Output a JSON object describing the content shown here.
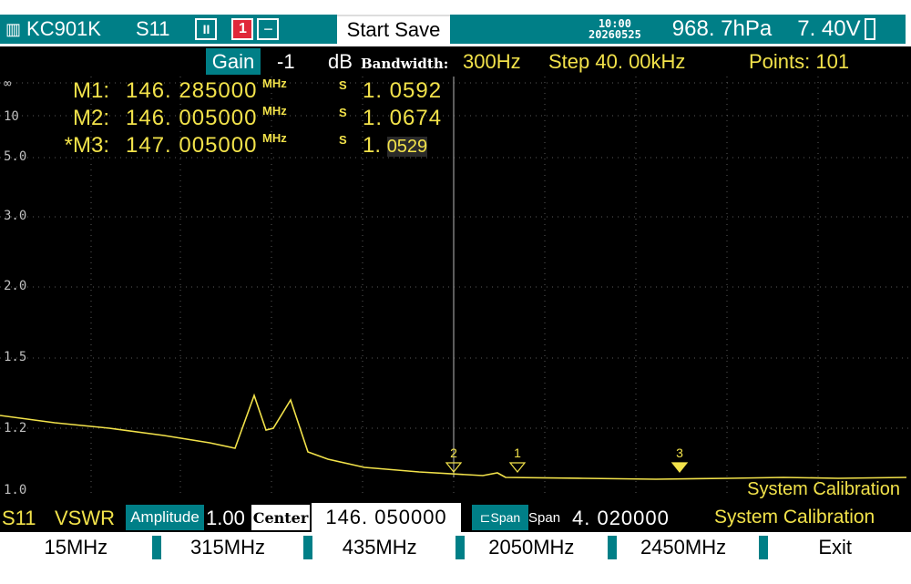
{
  "status": {
    "device": "KC901K",
    "mode": "S11",
    "pause_icon": "II",
    "channel": "1",
    "minus_icon": "−",
    "start_save": "Start Save",
    "time": "10:00",
    "date": "20260525",
    "pressure": "968. 7hPa",
    "voltage": "7. 40V"
  },
  "settings": {
    "gain_label": "Gain",
    "gain_value": "-1",
    "gain_unit": "dB",
    "bandwidth_label": "Bandwidth:",
    "bandwidth_value": "300Hz",
    "step": "Step  40. 00kHz",
    "points": "Points:  101"
  },
  "markers": [
    {
      "name": "M1:",
      "freq": "146. 285000",
      "unit": "MHz",
      "s": "S",
      "value": "1. 0592"
    },
    {
      "name": "M2:",
      "freq": "146. 005000",
      "unit": "MHz",
      "s": "S",
      "value": "1. 0674"
    },
    {
      "name": "*M3:",
      "freq": "147. 005000",
      "unit": "MHz",
      "s": "S",
      "value_int": "1.",
      "value_frac": "0529"
    }
  ],
  "plot": {
    "y_labels": [
      "∞",
      "10",
      "5.0",
      "3.0",
      "2.0",
      "1.5",
      "1.2",
      "1.0"
    ],
    "marker_flags": [
      "2",
      "1",
      "3"
    ],
    "calibration_note": "System Calibration"
  },
  "info": {
    "param": "S11",
    "format": "VSWR",
    "amplitude_label": "Amplitude",
    "amplitude_value": "1.00",
    "center_label": "Center",
    "center_value": "146. 050000",
    "span_icon_label": "Span",
    "span_label": "Span",
    "span_value": "4. 020000",
    "calibration": "System Calibration"
  },
  "softkeys": [
    "15MHz",
    "315MHz",
    "435MHz",
    "2050MHz",
    "2450MHz",
    "Exit"
  ],
  "colors": {
    "accent_teal": "#007f87",
    "trace_yellow": "#f2e24a",
    "channel_red": "#e0283a"
  }
}
